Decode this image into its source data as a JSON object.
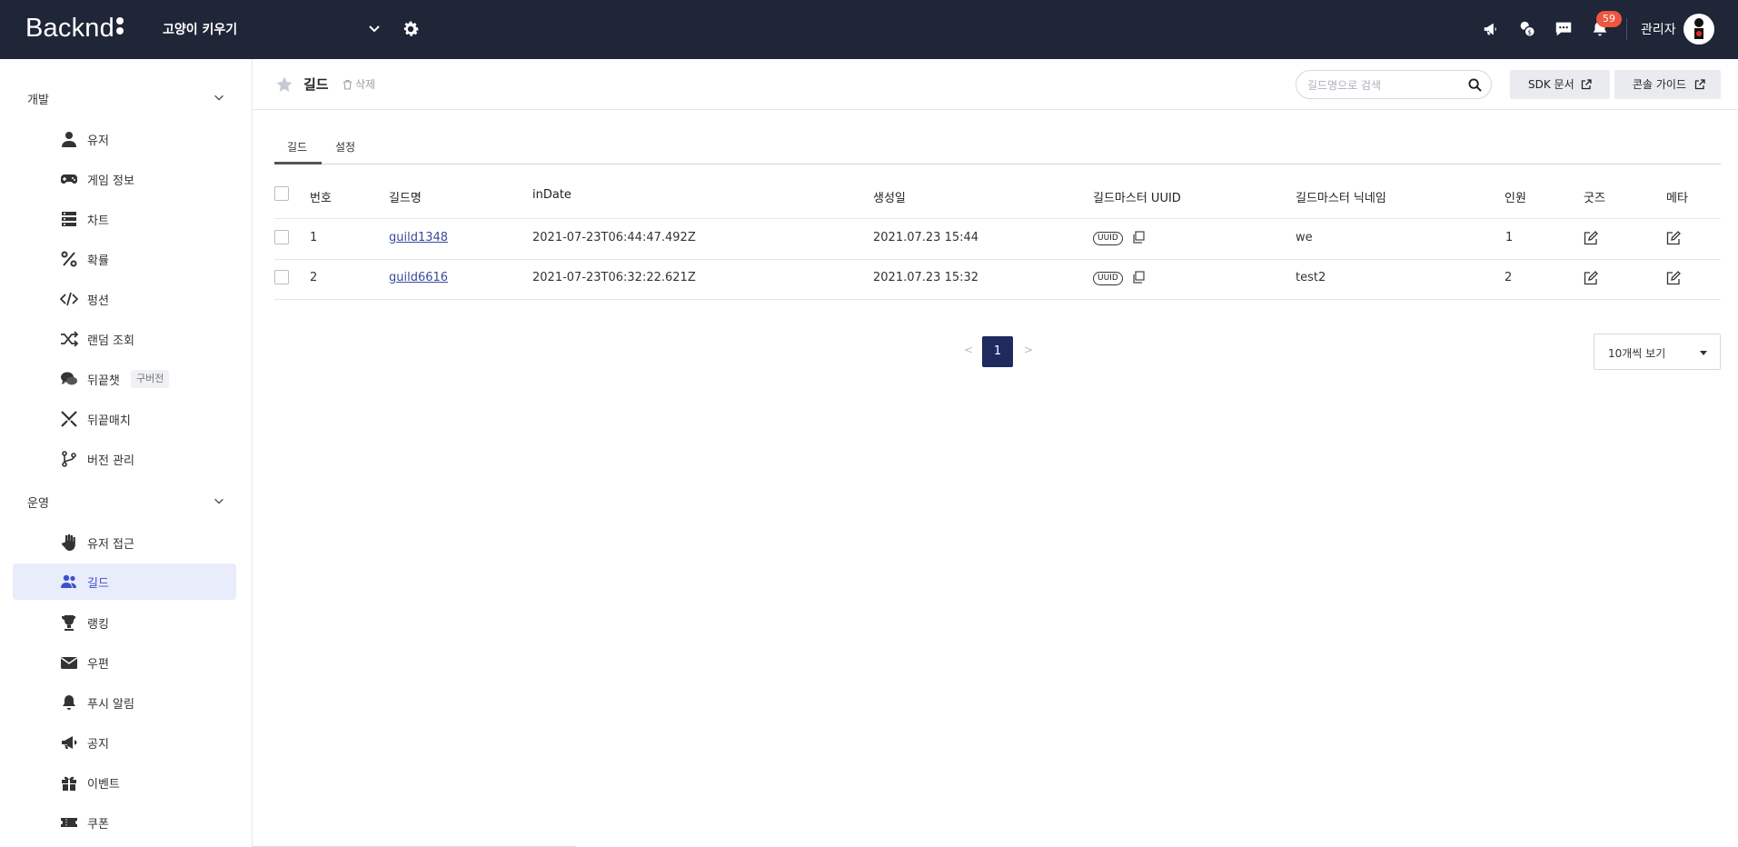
{
  "topbar": {
    "logo_text": "Backnd",
    "project_name": "고양이 키우기",
    "notification_count": "59",
    "admin_label": "관리자",
    "icons": [
      "megaphone-icon",
      "coins-icon",
      "chat-icon",
      "bell-icon"
    ]
  },
  "sidebar": {
    "section_dev": "개발",
    "section_ops": "운영",
    "dev_items": [
      {
        "label": "유저",
        "icon": "user-icon"
      },
      {
        "label": "게임 정보",
        "icon": "gamepad-icon"
      },
      {
        "label": "차트",
        "icon": "server-icon"
      },
      {
        "label": "확률",
        "icon": "percent-icon"
      },
      {
        "label": "펑션",
        "icon": "code-icon"
      },
      {
        "label": "랜덤 조회",
        "icon": "shuffle-icon"
      },
      {
        "label": "뒤끝챗",
        "icon": "chat-bubbles-icon",
        "tag": "구버전"
      },
      {
        "label": "뒤끝매치",
        "icon": "swords-icon"
      },
      {
        "label": "버전 관리",
        "icon": "branch-icon"
      }
    ],
    "ops_items": [
      {
        "label": "유저 접근",
        "icon": "hand-icon"
      },
      {
        "label": "길드",
        "icon": "users-icon",
        "active": true
      },
      {
        "label": "랭킹",
        "icon": "trophy-icon"
      },
      {
        "label": "우편",
        "icon": "envelope-icon"
      },
      {
        "label": "푸시 알림",
        "icon": "bell-icon"
      },
      {
        "label": "공지",
        "icon": "bullhorn-icon"
      },
      {
        "label": "이벤트",
        "icon": "gift-icon"
      },
      {
        "label": "쿠폰",
        "icon": "ticket-icon"
      }
    ]
  },
  "header": {
    "title": "길드",
    "delete_label": "삭제",
    "search_placeholder": "길드명으로 검색",
    "sdk_doc_label": "SDK 문서",
    "console_guide_label": "콘솔 가이드"
  },
  "tabs": [
    {
      "label": "길드",
      "active": true
    },
    {
      "label": "설정",
      "active": false
    }
  ],
  "table": {
    "columns": [
      "번호",
      "길드명",
      "inDate",
      "생성일",
      "길드마스터 UUID",
      "길드마스터 닉네임",
      "인원",
      "굿즈",
      "메타"
    ],
    "uuid_pill": "UUID",
    "rows": [
      {
        "no": "1",
        "name": "guild1348",
        "inDate": "2021-07-23T06:44:47.492Z",
        "created": "2021.07.23 15:44",
        "nickname": "we",
        "members": "1"
      },
      {
        "no": "2",
        "name": "guild6616",
        "inDate": "2021-07-23T06:32:22.621Z",
        "created": "2021.07.23 15:32",
        "nickname": "test2",
        "members": "2"
      }
    ]
  },
  "pagination": {
    "prev": "<",
    "current": "1",
    "next": ">",
    "per_page": "10개씩 보기"
  },
  "colors": {
    "topbar_bg": "#1f2637",
    "badge": "#f0553e",
    "active_nav_bg": "#e9ecfb",
    "pagination_active": "#1f2a5e"
  }
}
